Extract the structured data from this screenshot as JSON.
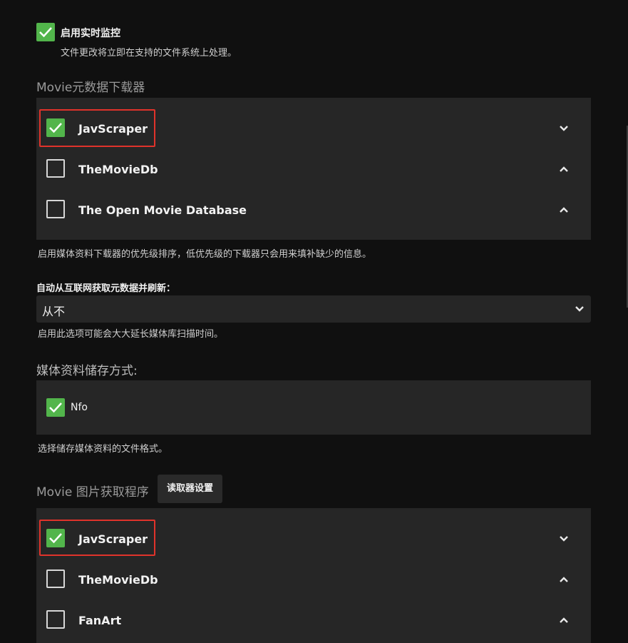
{
  "realtime_monitor": {
    "checked": true,
    "label": "启用实时监控",
    "hint": "文件更改将立即在支持的文件系统上处理。"
  },
  "metadata_downloaders": {
    "title": "Movie元数据下载器",
    "items": [
      {
        "label": "JavScraper",
        "checked": true,
        "chevron": "chevron-down-icon"
      },
      {
        "label": "TheMovieDb",
        "checked": false,
        "chevron": "chevron-up-icon"
      },
      {
        "label": "The Open Movie Database",
        "checked": false,
        "chevron": "chevron-up-icon"
      }
    ],
    "hint": "启用媒体资料下载器的优先级排序，低优先级的下载器只会用来填补缺少的信息。"
  },
  "auto_refresh": {
    "label": "自动从互联网获取元数据并刷新：",
    "selected": "从不",
    "hint": "启用此选项可能会大大延长媒体库扫描时间。"
  },
  "metadata_savers": {
    "title": "媒体资料储存方式:",
    "items": [
      {
        "label": "Nfo",
        "checked": true
      }
    ],
    "hint": "选择储存媒体资料的文件格式。"
  },
  "image_fetchers": {
    "title": "Movie 图片获取程序",
    "settings_button": "读取器设置",
    "items": [
      {
        "label": "JavScraper",
        "checked": true,
        "chevron": "chevron-down-icon"
      },
      {
        "label": "TheMovieDb",
        "checked": false,
        "chevron": "chevron-up-icon"
      },
      {
        "label": "FanArt",
        "checked": false,
        "chevron": "chevron-up-icon"
      }
    ]
  },
  "colors": {
    "background": "#101010",
    "panel": "#262626",
    "checked": "#52b54b",
    "highlight": "#e0332b"
  }
}
